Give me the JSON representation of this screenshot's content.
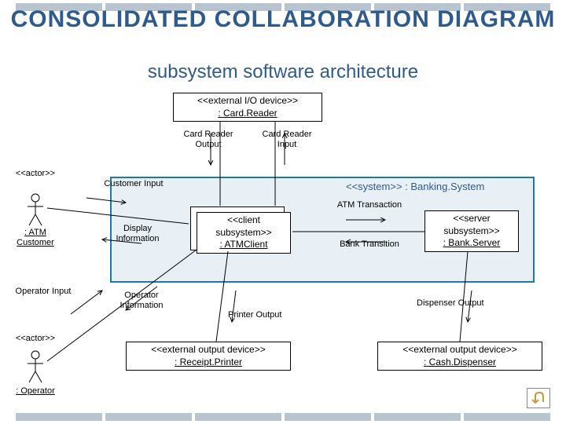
{
  "title": "CONSOLIDATED COLLABORATION DIAGRAM",
  "subtitle": "subsystem software architecture",
  "cardReader": {
    "st": "<<external I/O device>>",
    "nm": ": Card.Reader"
  },
  "atmClient": {
    "st": "<<client subsystem>>",
    "nm": ": ATMClient"
  },
  "bankServer": {
    "st": "<<server subsystem>>",
    "nm": ": Bank.Server"
  },
  "receiptPrinter": {
    "st": "<<external output device>>",
    "nm": ": Receipt.Printer"
  },
  "cashDispenser": {
    "st": "<<external output device>>",
    "nm": ": Cash.Dispenser"
  },
  "bankingSystem": "<<system>> : Banking.System",
  "labels": {
    "actorTop": "<<actor>>",
    "actorBot": "<<actor>>",
    "atmCustomer": ": ATM Customer",
    "operator": ": Operator",
    "customerInput": "Customer Input",
    "displayInfo": "Display Information",
    "operatorInput": "Operator Input",
    "operatorInfo": "Operator Information",
    "cardReaderOutput": "Card Reader Output",
    "cardReaderInput": "Card Reader Input",
    "atmTransaction": "ATM Transaction",
    "bankTransition": "Bank Transition",
    "printerOutput": "Printer Output",
    "dispenserOutput": "Dispenser Output"
  }
}
